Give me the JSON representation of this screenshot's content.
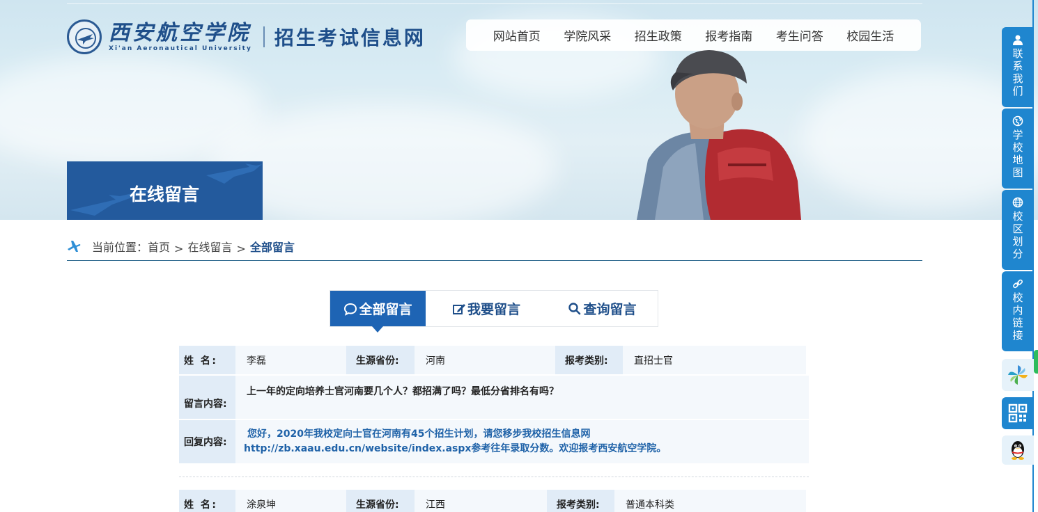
{
  "header": {
    "logo_cn": "西安航空学院",
    "logo_en": "Xi'an Aeronautical University",
    "site_name": "招生考试信息网"
  },
  "nav": {
    "items": [
      "网站首页",
      "学院风采",
      "招生政策",
      "报考指南",
      "考生问答",
      "校园生活"
    ]
  },
  "banner": {
    "title": "在线留言"
  },
  "breadcrumb": {
    "prefix": "当前位置：",
    "home": "首页",
    "sep": ">",
    "section": "在线留言",
    "current": "全部留言"
  },
  "tabs": [
    {
      "label": "全部留言",
      "icon": "chat-bubble-icon"
    },
    {
      "label": "我要留言",
      "icon": "edit-icon"
    },
    {
      "label": "查询留言",
      "icon": "search-icon"
    }
  ],
  "labels": {
    "name": "姓 名:",
    "province": "生源省份:",
    "category": "报考类别:",
    "content": "留言内容:",
    "reply": "回复内容:"
  },
  "messages": [
    {
      "name": "李磊",
      "province": "河南",
      "category": "直招士官",
      "content": "上一年的定向培养士官河南要几个人？都招满了吗？最低分省排名有吗？",
      "reply_line1": "您好，2020年我校定向士官在河南有45个招生计划，请您移步我校招生信息网",
      "reply_line2": "http://zb.xaau.edu.cn/website/index.aspx参考往年录取分数。欢迎报考西安航空学院。"
    },
    {
      "name": "涂泉坤",
      "province": "江西",
      "category": "普通本科类"
    }
  ],
  "sidebar": {
    "items": [
      {
        "label": "联系我们",
        "icon": "person-icon"
      },
      {
        "label": "学校地图",
        "icon": "globe-icon"
      },
      {
        "label": "校区划分",
        "icon": "grid-globe-icon"
      },
      {
        "label": "校内链接",
        "icon": "link-icon"
      }
    ],
    "squares": [
      "pinwheel-icon",
      "qr-code-icon",
      "qq-penguin-icon"
    ]
  },
  "colors": {
    "brand_blue": "#1f4f8a",
    "tab_active": "#1e64b4",
    "sidebar_blue": "#1f86cf",
    "reply_text": "#1f62a8"
  }
}
